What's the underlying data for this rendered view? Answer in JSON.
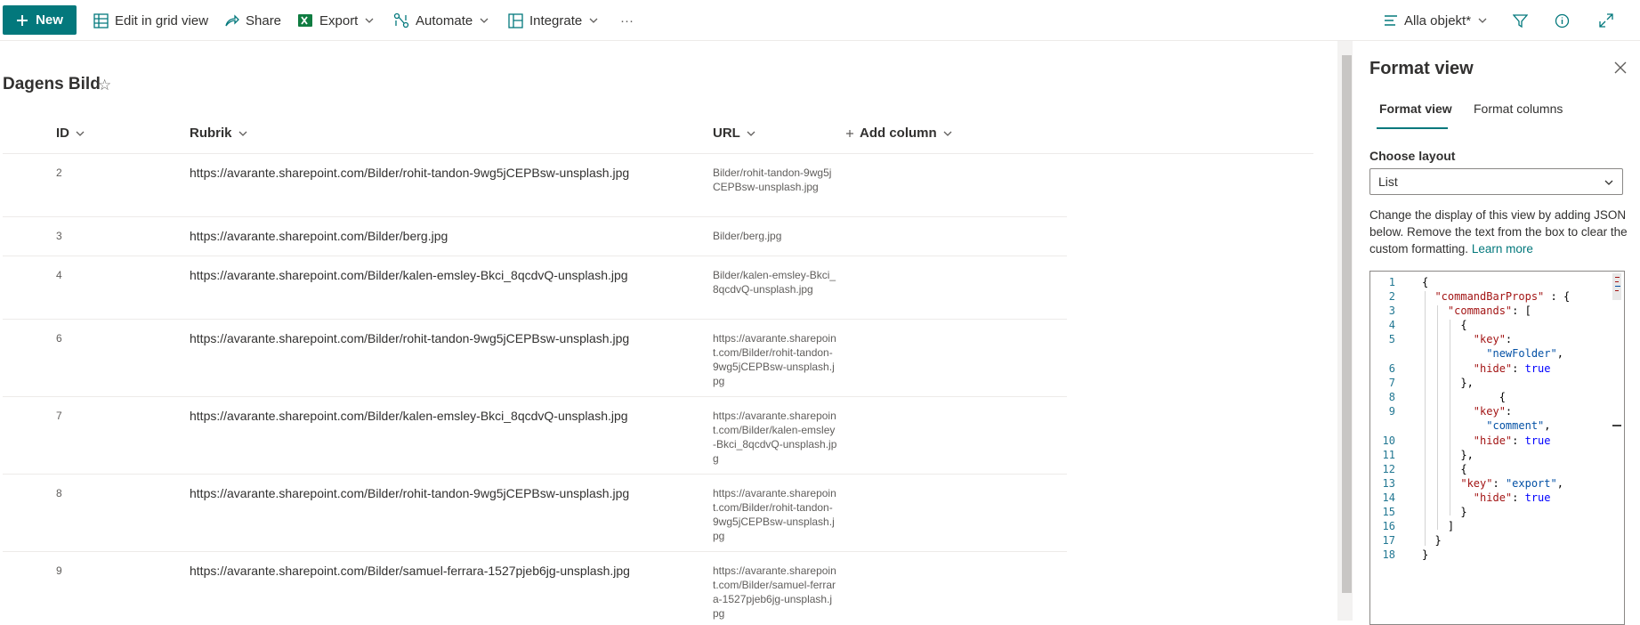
{
  "toolbar": {
    "new_label": "New",
    "edit_grid_label": "Edit in grid view",
    "share_label": "Share",
    "export_label": "Export",
    "automate_label": "Automate",
    "integrate_label": "Integrate",
    "more_label": "···",
    "view_label": "Alla objekt*"
  },
  "list": {
    "title": "Dagens Bild",
    "columns": {
      "id": "ID",
      "rubrik": "Rubrik",
      "url": "URL",
      "add": "Add column"
    },
    "rows": [
      {
        "id": "2",
        "rubrik": "https://avarante.sharepoint.com/Bilder/rohit-tandon-9wg5jCEPBsw-unsplash.jpg",
        "url": "Bilder/rohit-tandon-9wg5jCEPBsw-unsplash.jpg"
      },
      {
        "id": "3",
        "rubrik": "https://avarante.sharepoint.com/Bilder/berg.jpg",
        "url": "Bilder/berg.jpg"
      },
      {
        "id": "4",
        "rubrik": "https://avarante.sharepoint.com/Bilder/kalen-emsley-Bkci_8qcdvQ-unsplash.jpg",
        "url": "Bilder/kalen-emsley-Bkci_8qcdvQ-unsplash.jpg"
      },
      {
        "id": "6",
        "rubrik": "https://avarante.sharepoint.com/Bilder/rohit-tandon-9wg5jCEPBsw-unsplash.jpg",
        "url": "https://avarante.sharepoint.com/Bilder/rohit-tandon-9wg5jCEPBsw-unsplash.jpg"
      },
      {
        "id": "7",
        "rubrik": "https://avarante.sharepoint.com/Bilder/kalen-emsley-Bkci_8qcdvQ-unsplash.jpg",
        "url": "https://avarante.sharepoint.com/Bilder/kalen-emsley-Bkci_8qcdvQ-unsplash.jpg"
      },
      {
        "id": "8",
        "rubrik": "https://avarante.sharepoint.com/Bilder/rohit-tandon-9wg5jCEPBsw-unsplash.jpg",
        "url": "https://avarante.sharepoint.com/Bilder/rohit-tandon-9wg5jCEPBsw-unsplash.jpg"
      },
      {
        "id": "9",
        "rubrik": "https://avarante.sharepoint.com/Bilder/samuel-ferrara-1527pjeb6jg-unsplash.jpg",
        "url": "https://avarante.sharepoint.com/Bilder/samuel-ferrara-1527pjeb6jg-unsplash.jpg"
      }
    ]
  },
  "panel": {
    "title": "Format view",
    "tabs": [
      "Format view",
      "Format columns"
    ],
    "layout_label": "Choose layout",
    "layout_value": "List",
    "description": "Change the display of this view by adding JSON below. Remove the text from the box to clear the custom formatting.",
    "learn_more": "Learn more",
    "code_lines": [
      "1",
      "2",
      "3",
      "4",
      "5",
      "6",
      "7",
      "8",
      "9",
      "10",
      "11",
      "12",
      "13",
      "14",
      "15",
      "16",
      "17",
      "18"
    ]
  },
  "colors": {
    "accent": "#03787c",
    "text": "#323130",
    "muted": "#605e5c"
  }
}
